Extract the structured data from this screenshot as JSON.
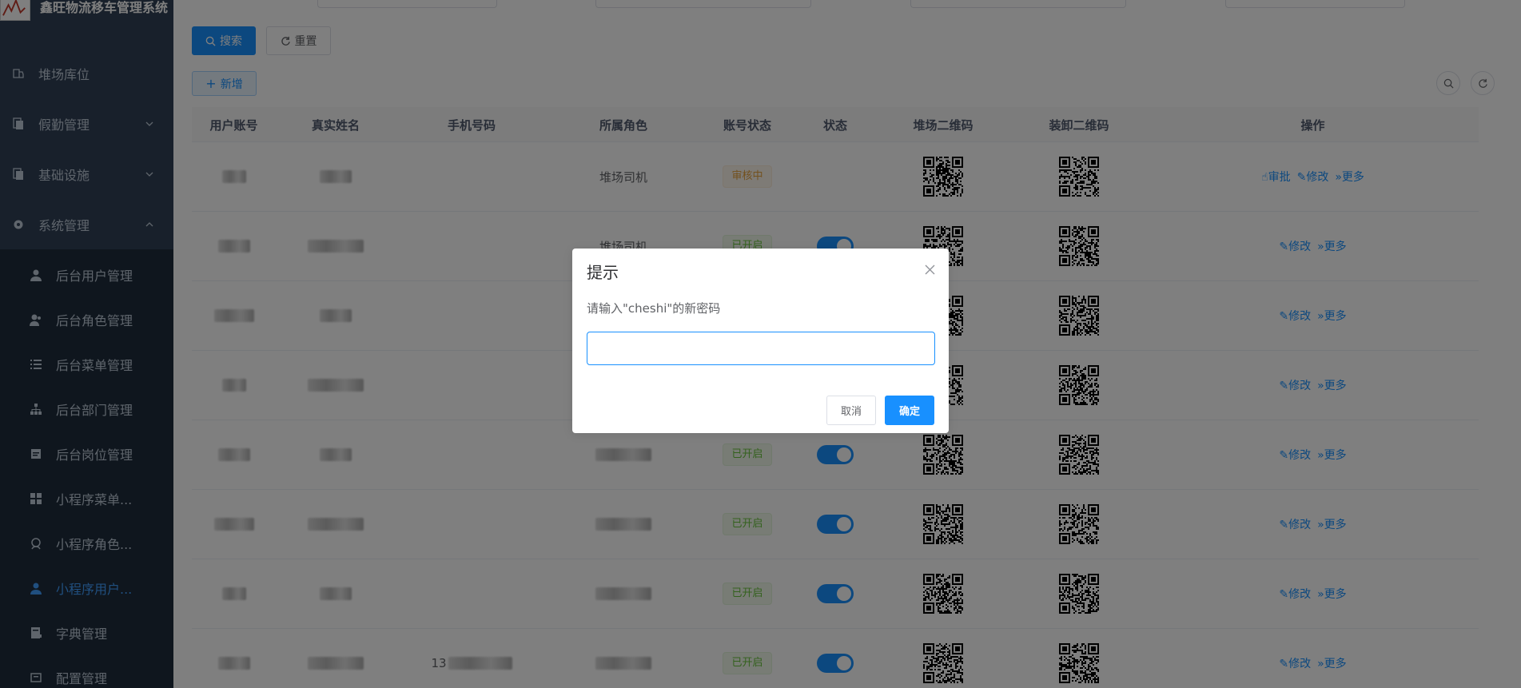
{
  "app": {
    "title": "鑫旺物流移车管理系统"
  },
  "sidebar": {
    "items": [
      {
        "label": "堆场库位",
        "icon": "parking-icon"
      },
      {
        "label": "假勤管理",
        "icon": "document-icon"
      },
      {
        "label": "基础设施",
        "icon": "document-icon"
      },
      {
        "label": "系统管理",
        "icon": "gear-icon"
      }
    ],
    "subitems": [
      {
        "label": "后台用户管理",
        "icon": "user-icon"
      },
      {
        "label": "后台角色管理",
        "icon": "role-icon"
      },
      {
        "label": "后台菜单管理",
        "icon": "list-icon"
      },
      {
        "label": "后台部门管理",
        "icon": "tree-icon"
      },
      {
        "label": "后台岗位管理",
        "icon": "post-icon"
      },
      {
        "label": "小程序菜单...",
        "icon": "grid-icon"
      },
      {
        "label": "小程序角色...",
        "icon": "role2-icon"
      },
      {
        "label": "小程序用户...",
        "icon": "user-icon",
        "active": true
      },
      {
        "label": "字典管理",
        "icon": "dict-icon"
      },
      {
        "label": "配置管理",
        "icon": "config-icon"
      }
    ]
  },
  "toolbar": {
    "search_label": "搜索",
    "reset_label": "重置",
    "add_label": "新增"
  },
  "table": {
    "headers": [
      "用户账号",
      "真实姓名",
      "手机号码",
      "所属角色",
      "账号状态",
      "状态",
      "堆场二维码",
      "装卸二维码",
      "操作"
    ],
    "rows": [
      {
        "role": "堆场司机",
        "status": "审核中",
        "status_type": "warn",
        "switch": false,
        "ops": [
          "审批",
          "修改",
          "更多"
        ]
      },
      {
        "role": "堆场司机",
        "status": "已开启",
        "status_type": "ok",
        "switch": true,
        "ops": [
          "修改",
          "更多"
        ]
      },
      {
        "role": "",
        "status": "",
        "status_type": "",
        "switch": false,
        "ops": [
          "修改",
          "更多"
        ]
      },
      {
        "role": "",
        "status": "",
        "status_type": "",
        "switch": false,
        "ops": [
          "修改",
          "更多"
        ]
      },
      {
        "role": "",
        "status": "已开启",
        "status_type": "ok",
        "switch": true,
        "ops": [
          "修改",
          "更多"
        ]
      },
      {
        "role": "",
        "status": "已开启",
        "status_type": "ok",
        "switch": true,
        "ops": [
          "修改",
          "更多"
        ]
      },
      {
        "role": "",
        "status": "已开启",
        "status_type": "ok",
        "switch": true,
        "ops": [
          "修改",
          "更多"
        ]
      },
      {
        "role": "",
        "phone": "13",
        "status": "已开启",
        "status_type": "ok",
        "switch": true,
        "ops": [
          "修改",
          "更多"
        ]
      }
    ]
  },
  "dialog": {
    "title": "提示",
    "message": "请输入\"cheshi\"的新密码",
    "input_value": "",
    "cancel_label": "取消",
    "confirm_label": "确定"
  }
}
